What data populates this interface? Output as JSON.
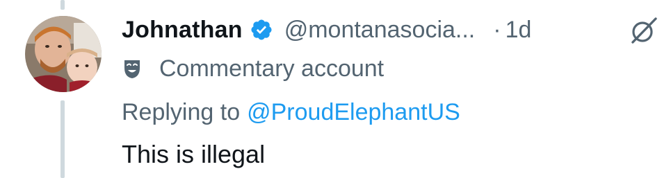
{
  "author": {
    "display_name": "Johnathan",
    "verified": true,
    "handle": "@montanasocia...",
    "separator": "·",
    "timestamp": "1d"
  },
  "account_label": {
    "icon": "comedy-mask-icon",
    "text": "Commentary account"
  },
  "reply": {
    "prefix": "Replying to",
    "mention": "@ProudElephantUS"
  },
  "post": {
    "text": "This is illegal"
  },
  "icons": {
    "verified": "verified-badge-icon",
    "grok": "grok-icon",
    "avatar": "avatar"
  },
  "colors": {
    "primary_text": "#0f1419",
    "secondary_text": "#536471",
    "link": "#1d9bf0",
    "verified_badge": "#1d9bf0",
    "thread_line": "#cfd9de"
  }
}
